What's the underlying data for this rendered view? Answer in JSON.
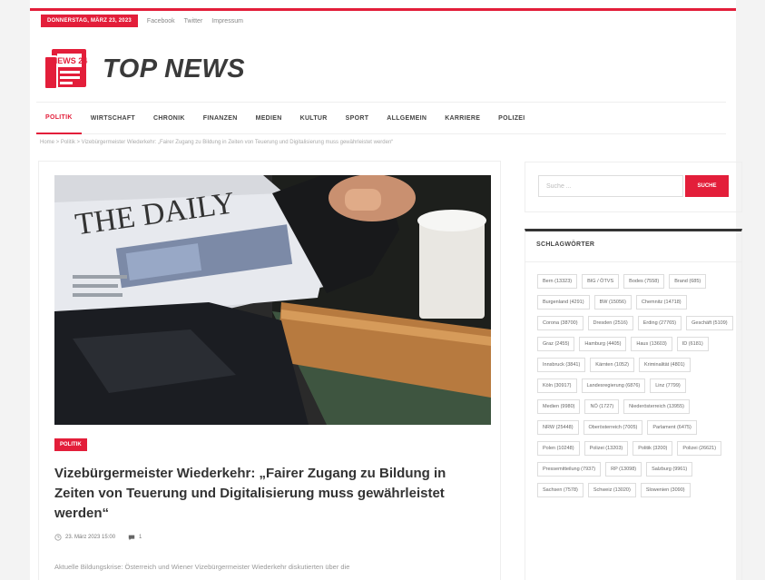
{
  "topbar": {
    "date": "DONNERSTAG, MÄRZ 23, 2023",
    "social": [
      "Facebook",
      "Twitter",
      "Impressum"
    ]
  },
  "logo": {
    "mark_text": "NEWS 24",
    "text": "TOP NEWS"
  },
  "nav": {
    "items": [
      "POLITIK",
      "WIRTSCHAFT",
      "CHRONIK",
      "FINANZEN",
      "MEDIEN",
      "KULTUR",
      "SPORT",
      "ALLGEMEIN",
      "KARRIERE",
      "POLIZEI"
    ],
    "active": "POLITIK"
  },
  "breadcrumb": "Home > Politik > Vizebürgermeister Wiederkehr: „Fairer Zugang zu Bildung in Zeiten von Teuerung und Digitalisierung muss gewährleistet werden“",
  "article": {
    "category": "POLITIK",
    "title": "Vizebürgermeister Wiederkehr: „Fairer Zugang zu Bildung in Zeiten von Teuerung und Digitalisierung muss gewährleistet werden“",
    "date": "23. März 2023 15:00",
    "comments": "1",
    "excerpt": "Aktuelle Bildungskrise: Österreich und Wiener Vizebürgermeister Wiederkehr diskutierten über die",
    "image_headline": "THE DAILY"
  },
  "search": {
    "placeholder": "Suche ...",
    "button": "SUCHE"
  },
  "tags": {
    "heading": "SCHLAGWÖRTER",
    "items": [
      "Bern (13323)",
      "BIG / ÖTVS",
      "Bodes (7558)",
      "Brand (685)",
      "Burgenland (4291)",
      "BW (15056)",
      "Chemnitz (14718)",
      "Corona (38700)",
      "Dresden (2516)",
      "Erding (27765)",
      "Geschäft (5109)",
      "Graz (2455)",
      "Hamburg (4405)",
      "Haus (13603)",
      "ID (6181)",
      "Innsbruck (3841)",
      "Kärnten (1052)",
      "Kriminalität (4801)",
      "Köln (30917)",
      "Landesregierung (6876)",
      "Linz (7799)",
      "Medien (9980)",
      "NÖ (1727)",
      "Niederösterreich (13955)",
      "NRW (25448)",
      "Oberösterreich (7005)",
      "Parlament (6475)",
      "Polen (10248)",
      "Polizei (13203)",
      "Politik (3200)",
      "Polizei (26621)",
      "Pressemitteilung (7937)",
      "RP (13098)",
      "Salzburg (9961)",
      "Sachsen (7578)",
      "Schweiz (13020)",
      "Slowenien (3090)"
    ]
  },
  "colors": {
    "accent": "#e31e3a",
    "text": "#333333",
    "muted": "#999999"
  },
  "icons": {
    "logo": "newspaper-logo-icon",
    "clock": "clock-icon",
    "comments": "comment-icon"
  }
}
